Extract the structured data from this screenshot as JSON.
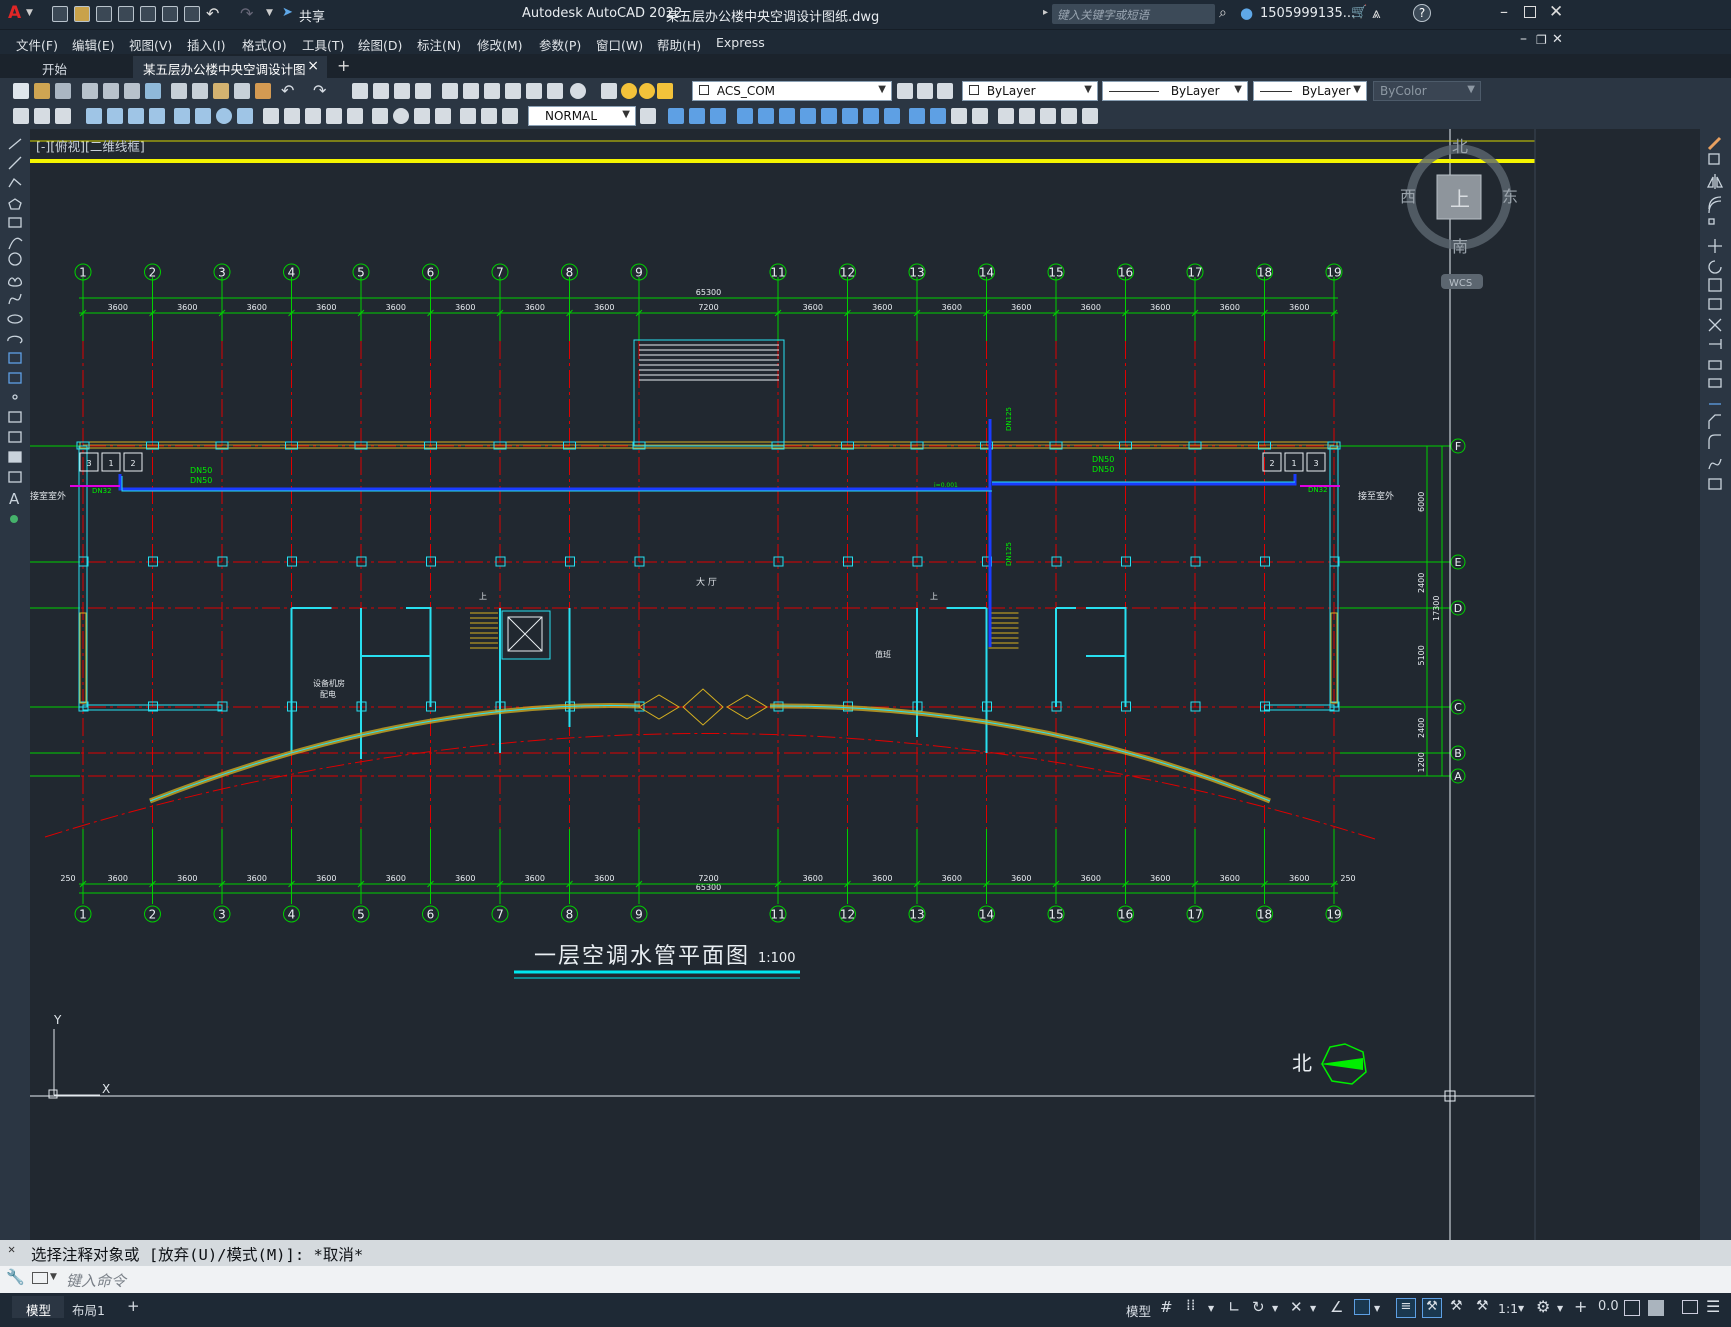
{
  "app": {
    "title": "Autodesk AutoCAD 2022",
    "filename": "某五层办公楼中央空调设计图纸.dwg",
    "share": "共享",
    "search_placeholder": "键入关键字或短语",
    "user": "1505999135...",
    "logo": "A"
  },
  "menu": [
    "文件(F)",
    "编辑(E)",
    "视图(V)",
    "插入(I)",
    "格式(O)",
    "工具(T)",
    "绘图(D)",
    "标注(N)",
    "修改(M)",
    "参数(P)",
    "窗口(W)",
    "帮助(H)",
    "Express"
  ],
  "tabs": {
    "start": "开始",
    "drawing": "某五层办公楼中央空调设计图纸*",
    "close": "×",
    "add": "+"
  },
  "props": {
    "layer": "ACS_COM",
    "color": "ByLayer",
    "linetype": "ByLayer",
    "lineweight": "ByLayer",
    "plotstyle": "ByColor",
    "textstyle": "NORMAL"
  },
  "viewport_label": "[-][俯视][二维线框]",
  "drawing": {
    "title": "一层空调水管平面图",
    "scale": "1:100",
    "axes": [
      "1",
      "2",
      "3",
      "4",
      "5",
      "6",
      "7",
      "8",
      "9",
      "11",
      "12",
      "13",
      "14",
      "15",
      "16",
      "17",
      "18",
      "19"
    ],
    "rows": [
      "F",
      "E",
      "D",
      "C",
      "B",
      "A"
    ],
    "total_dim": "65300",
    "spans": [
      "3600",
      "3600",
      "3600",
      "3600",
      "3600",
      "3600",
      "3600",
      "3600",
      "7200",
      "3600",
      "3600",
      "3600",
      "3600",
      "3600",
      "3600",
      "3600",
      "3600"
    ],
    "edge_dim": "250",
    "row_dims": [
      "6000",
      "2400",
      "5100",
      "2400",
      "1200"
    ],
    "row_total": "17300",
    "rooms": {
      "hall": "大 厅",
      "equip1": "设备机房",
      "equip2": "配电",
      "toilet": "值班",
      "up1": "上",
      "up2": "上"
    },
    "pipe_labels": {
      "dn50a": "DN50",
      "dn50b": "DN50",
      "dn32a": "DN32",
      "dn32b": "DN32",
      "dn125": "DN125",
      "dn50c": "DN50",
      "dn50d": "DN50",
      "slope": "i=0.001",
      "left_out": "接室室外",
      "right_out": "接至室外"
    },
    "north_label": "北",
    "ucs": {
      "x": "X",
      "y": "Y"
    }
  },
  "viewcube": {
    "top": "上",
    "n": "北",
    "s": "南",
    "e": "东",
    "w": "西",
    "wcs": "WCS"
  },
  "command": {
    "history": "选择注释对象或 [放弃(U)/模式(M)]: *取消*",
    "placeholder": "键入命令"
  },
  "status": {
    "model_tab": "模型",
    "layout_tab": "布局1",
    "add": "+",
    "model_btn": "模型",
    "scale": "1:1"
  }
}
